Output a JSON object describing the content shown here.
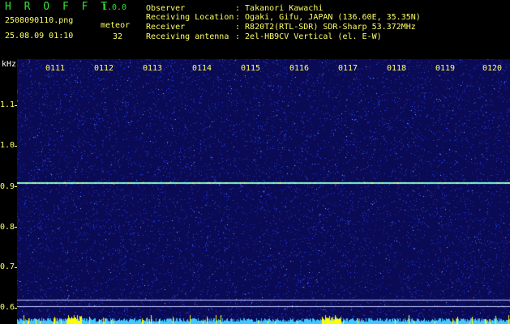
{
  "header": {
    "app_title": "H R O F F T",
    "app_version": "1.0.0",
    "filename": "2508090110.png",
    "timestamp": "25.08.09 01:10",
    "meteor_label": "meteor",
    "meteor_count": "32",
    "info": [
      {
        "label": "Observer",
        "value": ": Takanori Kawachi"
      },
      {
        "label": "Receiving Location",
        "value": ": Ogaki, Gifu, JAPAN (136.60E, 35.35N)"
      },
      {
        "label": "Receiver",
        "value": ": R820T2(RTL-SDR) SDR-Sharp 53.372MHz"
      },
      {
        "label": "Receiving antenna",
        "value": ": 2el-HB9CV Vertical (el. E-W)"
      }
    ]
  },
  "spectrogram": {
    "y_unit": "kHz",
    "y_ticks": [
      "1.1",
      "1.0",
      "0.9",
      "0.8",
      "0.7",
      "0.6"
    ],
    "x_ticks": [
      "0111",
      "0112",
      "0113",
      "0114",
      "0115",
      "0116",
      "0117",
      "0118",
      "0119",
      "0120"
    ],
    "signal_khz": 0.91,
    "colors": {
      "background": "#0a0a55",
      "noise": "#2a4bff",
      "signal": "#7fffd4",
      "level_bar": "#40c8ff",
      "level_peak": "#ffff00"
    }
  }
}
